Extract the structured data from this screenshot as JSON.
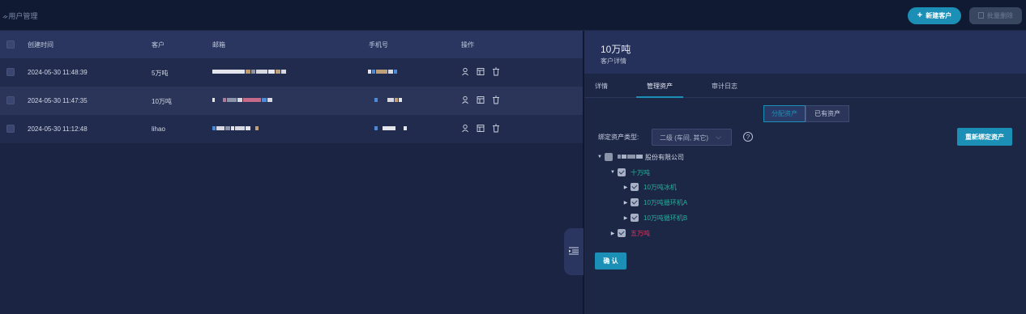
{
  "header": {
    "title": "ᨀ用户管理",
    "new_button": "新建客户",
    "batch_delete_button": "批量删除"
  },
  "table": {
    "columns": [
      "创建时间",
      "客户",
      "邮箱",
      "手机号",
      "操作"
    ],
    "rows": [
      {
        "created": "2024-05-30 11:48:39",
        "customer": "5万吨"
      },
      {
        "created": "2024-05-30 11:47:35",
        "customer": "10万吨"
      },
      {
        "created": "2024-05-30 11:12:48",
        "customer": "lihao"
      }
    ],
    "row_actions": [
      "user-icon",
      "table-icon",
      "trash-icon"
    ]
  },
  "detail": {
    "title": "10万吨",
    "subtitle": "客户详情",
    "tabs": [
      "详情",
      "管理资产",
      "审计日志"
    ],
    "active_tab": "管理资产",
    "segments": [
      "分配资产",
      "已有资产"
    ],
    "active_segment": "分配资产",
    "bind_type_label": "绑定资产类型:",
    "bind_type_value": "二级 (车间, 其它)",
    "rebind_button": "重新绑定资产",
    "tree": {
      "root": "股份有限公司",
      "nodes": [
        {
          "label": "十万吨",
          "level": 1,
          "checked": true,
          "color": "green"
        },
        {
          "label": "10万吨冰机",
          "level": 2,
          "checked": true,
          "color": "green"
        },
        {
          "label": "10万吨循环机A",
          "level": 2,
          "checked": true,
          "color": "green"
        },
        {
          "label": "10万吨循环机B",
          "level": 2,
          "checked": true,
          "color": "green"
        },
        {
          "label": "五万吨",
          "level": 1,
          "checked": true,
          "color": "red"
        }
      ]
    },
    "confirm_button": "确 认"
  },
  "colors": {
    "accent": "#1b8fb6",
    "green": "#24b29a",
    "red": "#e0325c"
  }
}
